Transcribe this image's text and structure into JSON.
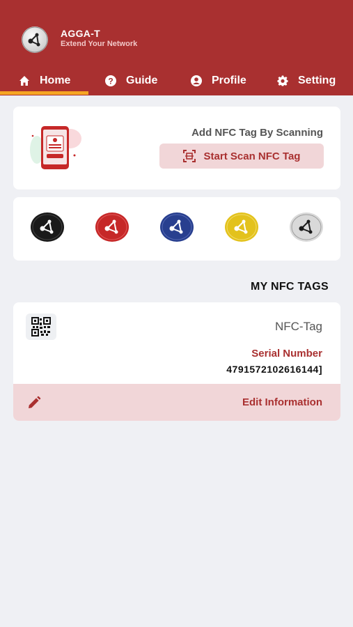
{
  "app": {
    "title": "AGGA-T",
    "subtitle": "Extend Your Network",
    "logo_icon": "share-nodes-icon"
  },
  "tabs": [
    {
      "label": "Home",
      "icon": "home-icon",
      "active": true
    },
    {
      "label": "Guide",
      "icon": "question-circle-icon",
      "active": false
    },
    {
      "label": "Profile",
      "icon": "user-circle-icon",
      "active": false
    },
    {
      "label": "Setting",
      "icon": "gear-icon",
      "active": false
    }
  ],
  "scan": {
    "title": "Add NFC Tag By Scanning",
    "button_label": "Start Scan NFC Tag",
    "button_icon": "scan-frame-icon"
  },
  "coins": [
    {
      "name": "black",
      "color": "#1a1a1a"
    },
    {
      "name": "red",
      "color": "#c62828"
    },
    {
      "name": "blue",
      "color": "#283f8f"
    },
    {
      "name": "yellow",
      "color": "#e3c21c"
    },
    {
      "name": "silver",
      "color": "#d9d9d9"
    }
  ],
  "my_tags": {
    "section_title": "MY NFC TAGS",
    "items": [
      {
        "name": "NFC-Tag",
        "serial_label": "Serial Number",
        "serial_value": "4791572102616144]",
        "edit_label": "Edit Information"
      }
    ]
  },
  "colors": {
    "primary": "#a93030",
    "accent": "#f5a623",
    "tint": "#f1d6d8",
    "background": "#eff0f4"
  }
}
